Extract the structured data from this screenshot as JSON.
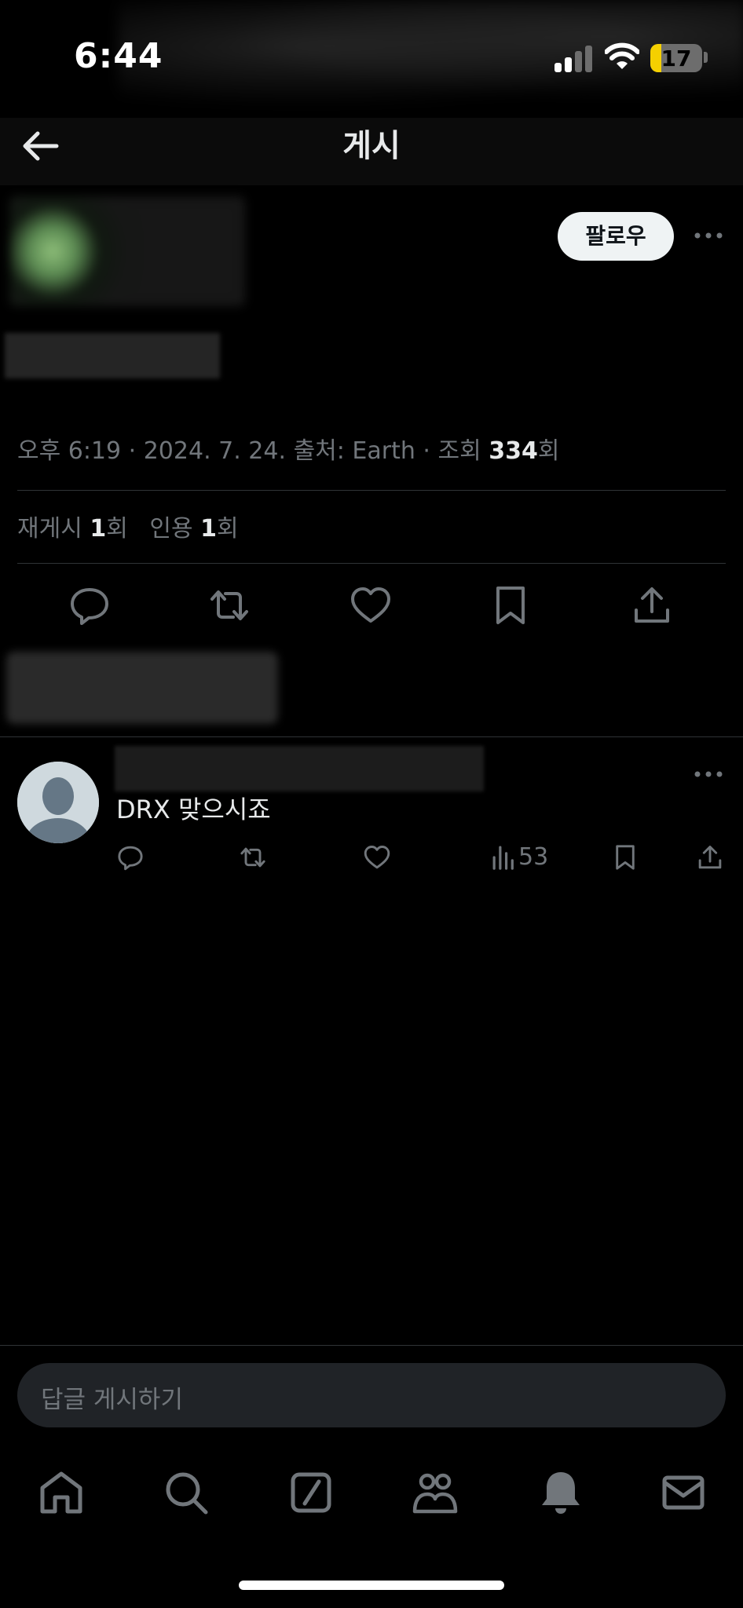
{
  "status_bar": {
    "time": "6:44",
    "battery": "17"
  },
  "header": {
    "title": "게시"
  },
  "post": {
    "follow_label": "팔로우",
    "meta": {
      "time": "오후 6:19",
      "date": "2024. 7. 24.",
      "source": "출처: Earth",
      "views_prefix": "조회",
      "views": "334",
      "views_suffix": "회"
    },
    "stats": {
      "reposts_label": "재게시",
      "reposts": "1",
      "quotes_label": "인용",
      "quotes": "1",
      "unit": "회"
    }
  },
  "reply": {
    "text": "DRX 맞으시죠",
    "views": "53"
  },
  "reply_box": {
    "placeholder": "답글 게시하기"
  },
  "icons": {
    "header": [
      "back-arrow-icon"
    ],
    "post_actions": [
      "reply-icon",
      "repost-icon",
      "like-icon",
      "bookmark-icon",
      "share-icon"
    ],
    "reply_actions": [
      "reply-icon",
      "repost-icon",
      "like-icon",
      "views-icon",
      "bookmark-icon",
      "share-icon"
    ],
    "tab_bar": [
      "home-icon",
      "search-icon",
      "grok-icon",
      "communities-icon",
      "notifications-icon",
      "messages-icon"
    ]
  },
  "colors": {
    "background": "#000000",
    "text_primary": "#e7e9ea",
    "text_secondary": "#71767b",
    "divider": "#2f3336",
    "battery_fill": "#f5d000"
  }
}
